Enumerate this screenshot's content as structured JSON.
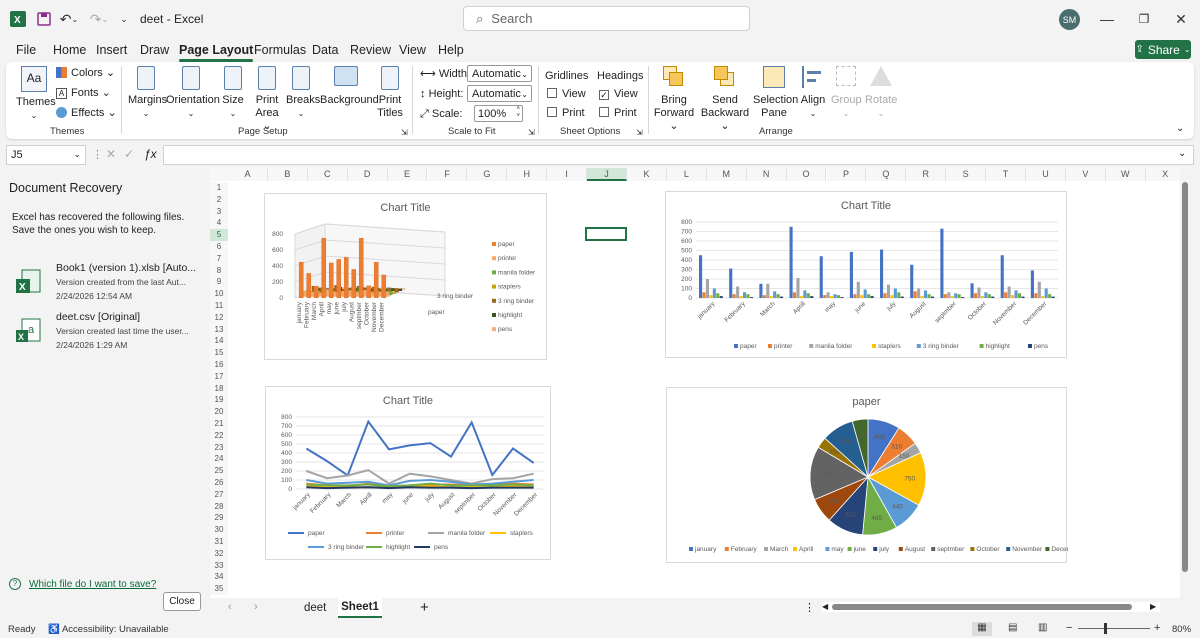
{
  "app": {
    "filename": "deet",
    "appname": "Excel",
    "title_sep": "-",
    "user_initials": "SM"
  },
  "search": {
    "placeholder": "Search"
  },
  "menu": [
    "File",
    "Home",
    "Insert",
    "Draw",
    "Page Layout",
    "Formulas",
    "Data",
    "Review",
    "View",
    "Help"
  ],
  "menu_active": "Page Layout",
  "share_label": "Share",
  "ribbon": {
    "themes": {
      "themes": "Themes",
      "colors": "Colors",
      "fonts": "Fonts",
      "effects": "Effects",
      "group": "Themes"
    },
    "page_setup": {
      "margins": "Margins",
      "orientation": "Orientation",
      "size": "Size",
      "print_area_1": "Print",
      "print_area_2": "Area",
      "breaks": "Breaks",
      "background": "Background",
      "print_titles_1": "Print",
      "print_titles_2": "Titles",
      "group": "Page Setup"
    },
    "scale": {
      "width_label": "Width:",
      "width_value": "Automatic",
      "height_label": "Height:",
      "height_value": "Automatic",
      "scale_label": "Scale:",
      "scale_value": "100%",
      "group": "Scale to Fit"
    },
    "sheet_options": {
      "gridlines": "Gridlines",
      "headings": "Headings",
      "view": "View",
      "print": "Print",
      "group": "Sheet Options",
      "gridlines_view": false,
      "gridlines_print": false,
      "headings_view": true,
      "headings_print": false
    },
    "arrange": {
      "bring_forward_1": "Bring",
      "bring_forward_2": "Forward",
      "send_backward_1": "Send",
      "send_backward_2": "Backward",
      "selection_pane_1": "Selection",
      "selection_pane_2": "Pane",
      "align": "Align",
      "group_btn": "Group",
      "rotate": "Rotate",
      "group": "Arrange"
    }
  },
  "namebox": "J5",
  "recovery": {
    "title": "Document Recovery",
    "desc_1": "Excel has recovered the following files.",
    "desc_2": "Save the ones you wish to keep.",
    "files": [
      {
        "name": "Book1 (version 1).xlsb  [Auto...",
        "detail": "Version created from the last Aut...",
        "time": "2/24/2026 12:54 AM"
      },
      {
        "name": "deet.csv  [Original]",
        "detail": "Version created last time the user...",
        "time": "2/24/2026 1:29 AM"
      }
    ],
    "help_link": "Which file do I want to save?",
    "close": "Close"
  },
  "columns": [
    "A",
    "B",
    "C",
    "D",
    "E",
    "F",
    "G",
    "H",
    "I",
    "J",
    "K",
    "L",
    "M",
    "N",
    "O",
    "P",
    "Q",
    "R",
    "S",
    "T",
    "U",
    "V",
    "W",
    "X"
  ],
  "rows": [
    "1",
    "2",
    "3",
    "4",
    "5",
    "6",
    "7",
    "8",
    "9",
    "10",
    "11",
    "12",
    "13",
    "14",
    "15",
    "16",
    "17",
    "18",
    "19",
    "20",
    "21",
    "22",
    "23",
    "24",
    "25",
    "26",
    "27",
    "28",
    "29",
    "30",
    "31",
    "32",
    "33",
    "34",
    "35"
  ],
  "sheets": {
    "tab1": "deet",
    "tab2": "Sheet1",
    "active": "Sheet1"
  },
  "status": {
    "ready": "Ready",
    "accessibility": "Accessibility: Unavailable",
    "zoom": "80%"
  },
  "colors": {
    "accent": "#217346"
  },
  "chart_data": [
    {
      "type": "bar",
      "title": "Chart Title",
      "variant": "3d-column",
      "categories": [
        "january",
        "February",
        "March",
        "Aprill",
        "may",
        "june",
        "july",
        "August",
        "septmber",
        "October",
        "November",
        "December"
      ],
      "ylim": [
        0,
        800
      ],
      "yticks": [
        "800",
        "600",
        "400",
        "200",
        "0"
      ],
      "depth_labels": [
        "3 ring binder",
        "paper"
      ],
      "series": [
        {
          "name": "paper",
          "color": "#ed7d31",
          "values": [
            450,
            310,
            150,
            750,
            440,
            485,
            510,
            360,
            750,
            155,
            450,
            290
          ]
        },
        {
          "name": "printer",
          "color": "#f5a86a",
          "values": [
            70,
            60,
            50,
            90,
            60,
            70,
            80,
            55,
            85,
            50,
            60,
            60
          ]
        },
        {
          "name": "manila folder",
          "color": "#70ad47",
          "values": [
            60,
            50,
            40,
            70,
            45,
            60,
            70,
            50,
            60,
            45,
            50,
            55
          ]
        },
        {
          "name": "staplers",
          "color": "#c9a200",
          "values": [
            30,
            20,
            25,
            40,
            20,
            30,
            35,
            25,
            30,
            20,
            30,
            25
          ]
        },
        {
          "name": "3 ring binder",
          "color": "#a0681c",
          "values": [
            80,
            60,
            50,
            90,
            40,
            60,
            80,
            60,
            70,
            40,
            60,
            50
          ]
        },
        {
          "name": "highlight",
          "color": "#375623",
          "values": [
            40,
            30,
            30,
            50,
            30,
            40,
            45,
            30,
            40,
            30,
            35,
            30
          ]
        },
        {
          "name": "pens",
          "color": "#f4b183",
          "values": [
            20,
            15,
            15,
            25,
            15,
            20,
            20,
            15,
            20,
            15,
            20,
            15
          ]
        }
      ]
    },
    {
      "type": "bar",
      "title": "Chart Title",
      "categories": [
        "january",
        "February",
        "March",
        "Aprill",
        "may",
        "june",
        "july",
        "August",
        "septmber",
        "October",
        "November",
        "December"
      ],
      "ylim": [
        0,
        800
      ],
      "yticks": [
        "800",
        "700",
        "600",
        "500",
        "400",
        "300",
        "200",
        "100",
        "0"
      ],
      "series": [
        {
          "name": "paper",
          "color": "#4472c4",
          "values": [
            450,
            310,
            150,
            750,
            440,
            485,
            510,
            350,
            730,
            155,
            450,
            290
          ]
        },
        {
          "name": "printer",
          "color": "#ed7d31",
          "values": [
            60,
            40,
            30,
            60,
            30,
            40,
            50,
            70,
            40,
            50,
            60,
            50
          ]
        },
        {
          "name": "manila folder",
          "color": "#a5a5a5",
          "values": [
            200,
            120,
            150,
            210,
            60,
            170,
            140,
            100,
            60,
            110,
            120,
            170
          ]
        },
        {
          "name": "staplers",
          "color": "#ffc000",
          "values": [
            30,
            20,
            20,
            20,
            20,
            30,
            30,
            20,
            20,
            20,
            30,
            20
          ]
        },
        {
          "name": "3 ring binder",
          "color": "#5b9bd5",
          "values": [
            100,
            60,
            70,
            80,
            40,
            90,
            100,
            80,
            50,
            60,
            80,
            100
          ]
        },
        {
          "name": "highlight",
          "color": "#70ad47",
          "values": [
            50,
            40,
            40,
            50,
            30,
            40,
            60,
            40,
            40,
            40,
            50,
            40
          ]
        },
        {
          "name": "pens",
          "color": "#264478",
          "values": [
            20,
            10,
            15,
            20,
            10,
            20,
            15,
            15,
            10,
            15,
            15,
            15
          ]
        }
      ]
    },
    {
      "type": "line",
      "title": "Chart Title",
      "categories": [
        "january",
        "February",
        "March",
        "Aprill",
        "may",
        "june",
        "july",
        "August",
        "septmber",
        "October",
        "November",
        "December"
      ],
      "ylim": [
        0,
        800
      ],
      "yticks": [
        "800",
        "700",
        "600",
        "500",
        "400",
        "300",
        "200",
        "100",
        "0"
      ],
      "series": [
        {
          "name": "paper",
          "color": "#4472c4",
          "values": [
            450,
            310,
            150,
            750,
            440,
            485,
            510,
            360,
            740,
            155,
            450,
            290
          ]
        },
        {
          "name": "printer",
          "color": "#ed7d31",
          "values": [
            60,
            40,
            30,
            60,
            30,
            40,
            50,
            50,
            40,
            50,
            60,
            50
          ]
        },
        {
          "name": "manila folder",
          "color": "#a5a5a5",
          "values": [
            200,
            120,
            150,
            210,
            60,
            170,
            140,
            100,
            60,
            110,
            120,
            170
          ]
        },
        {
          "name": "staplers",
          "color": "#ffc000",
          "values": [
            30,
            20,
            20,
            20,
            20,
            30,
            30,
            20,
            20,
            20,
            30,
            20
          ]
        },
        {
          "name": "3 ring binder",
          "color": "#5b9bd5",
          "values": [
            100,
            60,
            70,
            80,
            40,
            90,
            100,
            80,
            50,
            60,
            80,
            100
          ]
        },
        {
          "name": "highlight",
          "color": "#70ad47",
          "values": [
            50,
            40,
            40,
            50,
            30,
            40,
            60,
            40,
            40,
            40,
            50,
            40
          ]
        },
        {
          "name": "pens",
          "color": "#1f3864",
          "values": [
            20,
            10,
            15,
            20,
            10,
            20,
            15,
            15,
            10,
            15,
            15,
            15
          ]
        }
      ]
    },
    {
      "type": "pie",
      "title": "paper",
      "categories": [
        "january",
        "February",
        "March",
        "Aprill",
        "may",
        "june",
        "july",
        "August",
        "septmber",
        "October",
        "November",
        "December"
      ],
      "values": [
        450,
        310,
        150,
        750,
        440,
        485,
        510,
        350,
        750,
        155,
        450,
        220
      ],
      "colors": [
        "#4472c4",
        "#ed7d31",
        "#a5a5a5",
        "#ffc000",
        "#5b9bd5",
        "#70ad47",
        "#264478",
        "#9e480e",
        "#636363",
        "#997300",
        "#255e91",
        "#43682b"
      ]
    }
  ]
}
